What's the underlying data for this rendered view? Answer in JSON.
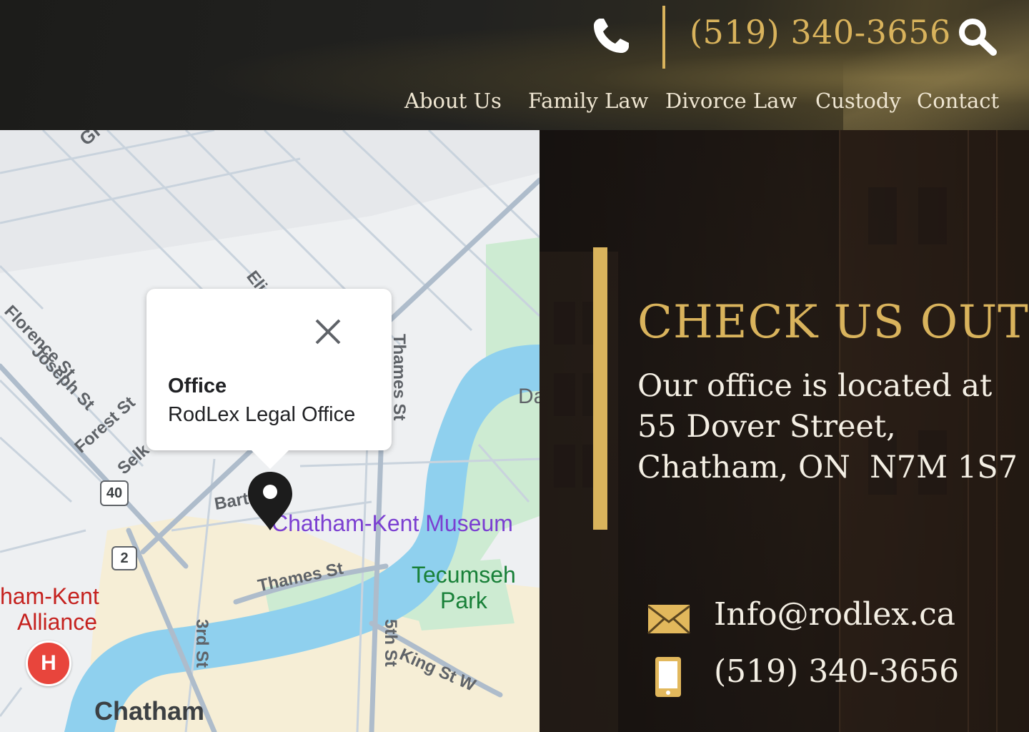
{
  "header": {
    "phone": "(519) 340-3656",
    "icons": {
      "phone": "phone-icon",
      "search": "search-icon"
    },
    "nav": [
      {
        "label": "About Us"
      },
      {
        "label": "Family Law"
      },
      {
        "label": "Divorce Law"
      },
      {
        "label": "Custody"
      },
      {
        "label": "Contact"
      }
    ]
  },
  "map": {
    "popup": {
      "title": "Office",
      "subtitle": "RodLex Legal Office"
    },
    "labels": {
      "florence": "Florence St",
      "joseph": "Joseph St",
      "forest": "Forest St",
      "selkirk": "Selk",
      "barthe": "Bart",
      "thames_st": "Thames St",
      "thames_ns": "Thames St",
      "museum": "Chatham-Kent Museum",
      "park": "Tecumseh\nPark",
      "king": "King St W",
      "third": "3rd St",
      "fifth": "5th St",
      "chatham": "Chatham",
      "alliance": "ham-Kent\nAlliance",
      "route40": "40",
      "route2": "2",
      "hospital": "H",
      "gl": "Gl",
      "eli": "Eli",
      "da": "Da"
    }
  },
  "info": {
    "heading": "CHECK US OUT",
    "address_lines": [
      "Our office is located at",
      "55 Dover Street,",
      "Chatham, ON  N7M 1S7"
    ],
    "email": "Info@rodlex.ca",
    "phone": "(519) 340-3656",
    "icons": {
      "mail": "mail-icon",
      "mobile": "mobile-phone-icon"
    }
  },
  "colors": {
    "gold": "#d9b35c",
    "cream": "#f4efe4",
    "river": "#8fd0ee",
    "museum_purple": "#7b3fd1",
    "park_green": "#188038",
    "hospital_red": "#e8453c"
  }
}
